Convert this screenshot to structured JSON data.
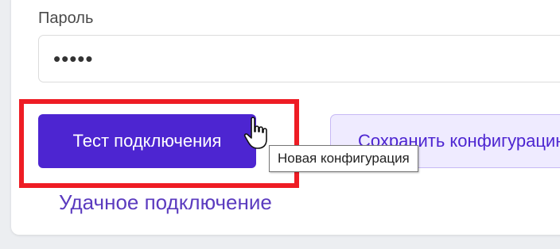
{
  "form": {
    "password_label": "Пароль",
    "password_value": "•••••",
    "test_button_label": "Тест подключения",
    "save_button_label": "Сохранить конфигурацию",
    "status_text": "Удачное подключение"
  },
  "tooltip": {
    "text": "Новая конфигурация"
  },
  "icons": {
    "cursor": "hand-pointer-icon"
  },
  "colors": {
    "primary": "#4d25d1",
    "highlight": "#ee1c24",
    "status": "#5b3bbf",
    "secondary_bg": "#efebff"
  }
}
